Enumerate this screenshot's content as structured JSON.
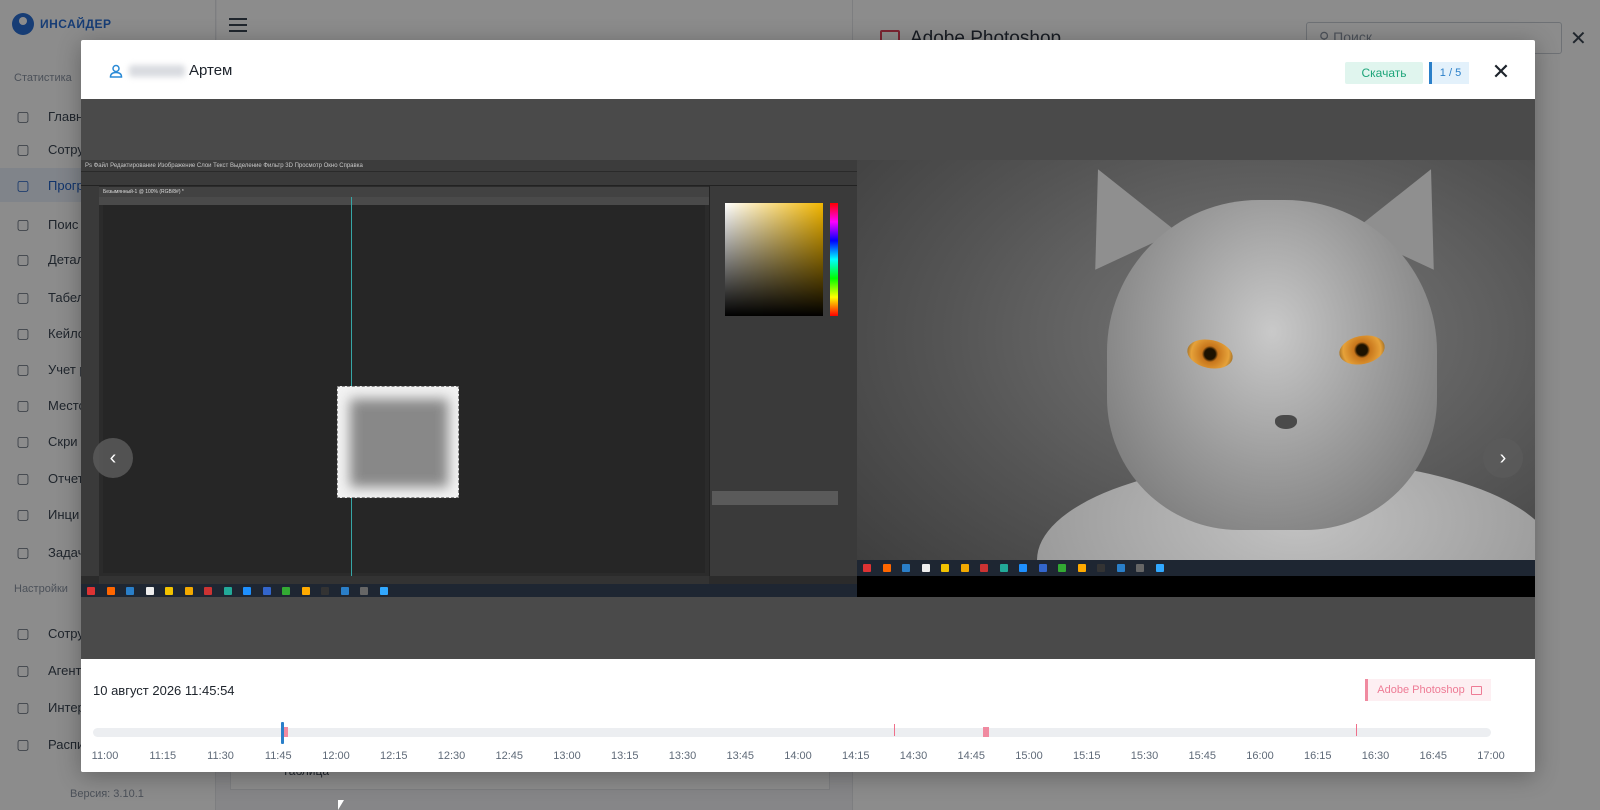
{
  "background": {
    "brand": "ИНСАЙДЕР",
    "sidebar": {
      "section_stats": "Статистика",
      "section_settings": "Настройки",
      "items": [
        {
          "label": "Главн",
          "icon": "dashboard-icon"
        },
        {
          "label": "Сотру",
          "icon": "users-icon"
        },
        {
          "label": "Прогр",
          "icon": "window-icon"
        },
        {
          "label": "Поис",
          "icon": "search-icon"
        },
        {
          "label": "Детал",
          "icon": "chart-line-icon"
        },
        {
          "label": "Табел",
          "icon": "document-icon"
        },
        {
          "label": "Кейло",
          "icon": "keyboard-icon"
        },
        {
          "label": "Учет р",
          "icon": "clock-icon"
        },
        {
          "label": "Местс",
          "icon": "location-icon"
        },
        {
          "label": "Скри",
          "icon": "screen-icon"
        },
        {
          "label": "Отчет",
          "icon": "report-icon"
        },
        {
          "label": "Инци",
          "icon": "alert-icon"
        },
        {
          "label": "Задач",
          "icon": "check-icon"
        }
      ],
      "settings_items": [
        {
          "label": "Сотру",
          "icon": "users-settings-icon"
        },
        {
          "label": "Агент",
          "icon": "agent-icon"
        },
        {
          "label": "Интер",
          "icon": "building-icon"
        },
        {
          "label": "Распи",
          "icon": "schedule-icon"
        }
      ],
      "version": "Версия: 3.10.1"
    },
    "right_panel": {
      "title": "Adobe Photoshop",
      "search_placeholder": "Поиск"
    },
    "mid_label": "Таблица"
  },
  "modal": {
    "user_name": "Артем",
    "download_label": "Скачать",
    "counter": "1 / 5",
    "close_label": "✕",
    "prev_label": "‹",
    "next_label": "›",
    "screenshot": {
      "left_app": "Adobe Photoshop",
      "ps_menu": "Ps  Файл  Редактирование  Изображение  Слои  Текст  Выделение  Фильтр  3D  Просмотр  Окно  Справка",
      "ps_tab": "Безымянный-1 @ 100% (RGB/8#) *"
    },
    "footer": {
      "timestamp": "10 август 2026 11:45:54",
      "app_badge": "Adobe Photoshop",
      "timeline": {
        "labels": [
          "11:00",
          "11:15",
          "11:30",
          "11:45",
          "12:00",
          "12:15",
          "12:30",
          "12:45",
          "13:00",
          "13:15",
          "13:30",
          "13:45",
          "14:00",
          "14:15",
          "14:30",
          "14:45",
          "15:00",
          "15:15",
          "15:30",
          "15:45",
          "16:00",
          "16:15",
          "16:30",
          "16:45",
          "17:00"
        ],
        "start": "11:00",
        "end": "17:00",
        "current": "11:45:54",
        "events": [
          "11:46",
          "14:25",
          "14:48",
          "16:25"
        ]
      }
    }
  },
  "colors": {
    "accent": "#2a7fc9",
    "download_bg": "#e0f5ee",
    "download_text": "#1ea57a",
    "badge_pink": "#ee7b95"
  }
}
